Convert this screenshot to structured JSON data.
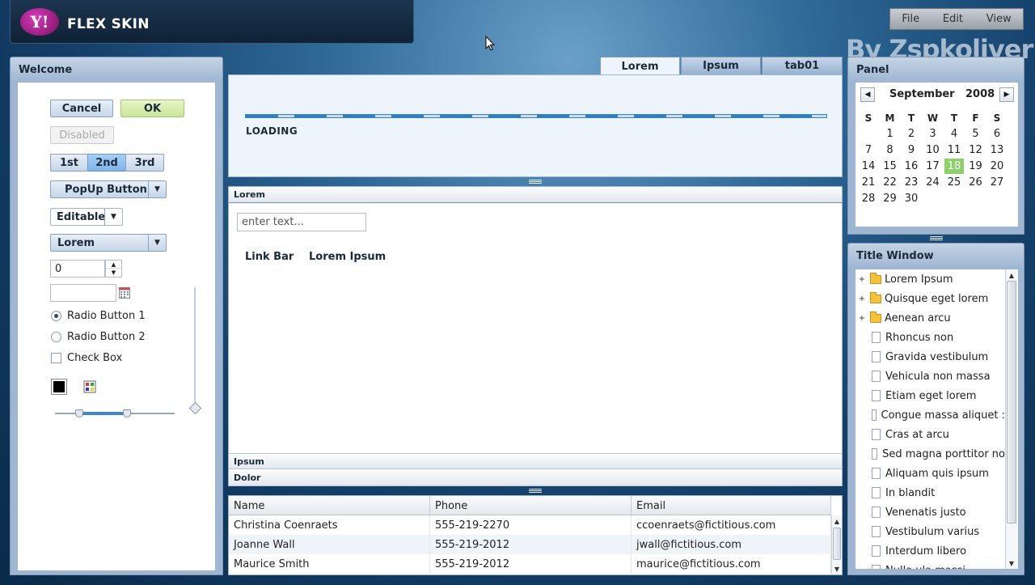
{
  "header": {
    "logo_glyph": "Y!",
    "logo_text": "FLEX SKIN"
  },
  "menubar": {
    "items": [
      "File",
      "Edit",
      "View"
    ]
  },
  "watermark": "By Zspkoliver",
  "welcome": {
    "title": "Welcome",
    "cancel": "Cancel",
    "ok": "OK",
    "disabled": "Disabled",
    "toggle": [
      "1st",
      "2nd",
      "3rd"
    ],
    "popup": "PopUp Button",
    "editable": "Editable",
    "combo": "Lorem",
    "stepper_value": "0",
    "radio1": "Radio Button 1",
    "radio2": "Radio Button 2",
    "checkbox": "Check Box",
    "slider_thumbs": [
      0.2,
      0.6
    ],
    "color_swatch": "#000000"
  },
  "tabs": {
    "items": [
      "Lorem",
      "Ipsum",
      "tab01"
    ],
    "active": "Lorem"
  },
  "progress": {
    "label": "LOADING"
  },
  "accordion": {
    "headers": [
      "Lorem",
      "Ipsum",
      "Dolor"
    ],
    "input_placeholder": "enter text...",
    "linkbar": [
      "Link Bar",
      "Lorem Ipsum"
    ]
  },
  "grid": {
    "columns": [
      "Name",
      "Phone",
      "Email"
    ],
    "rows": [
      [
        "Christina Coenraets",
        "555-219-2270",
        "ccoenraets@fictitious.com"
      ],
      [
        "Joanne Wall",
        "555-219-2012",
        "jwall@fictitious.com"
      ],
      [
        "Maurice Smith",
        "555-219-2012",
        "maurice@fictitious.com"
      ]
    ]
  },
  "calendar": {
    "title": "Panel",
    "month": "September",
    "year": "2008",
    "dow": [
      "S",
      "M",
      "T",
      "W",
      "T",
      "F",
      "S"
    ],
    "weeks": [
      [
        "",
        "1",
        "2",
        "3",
        "4",
        "5",
        "6"
      ],
      [
        "7",
        "8",
        "9",
        "10",
        "11",
        "12",
        "13"
      ],
      [
        "14",
        "15",
        "16",
        "17",
        "18",
        "19",
        "20"
      ],
      [
        "21",
        "22",
        "23",
        "24",
        "25",
        "26",
        "27"
      ],
      [
        "28",
        "29",
        "30",
        "",
        "",
        "",
        ""
      ]
    ],
    "today": "18",
    "today_color": "#8cd06a"
  },
  "titlewindow": {
    "title": "Title Window",
    "tree": [
      {
        "label": "Lorem Ipsum",
        "type": "folder"
      },
      {
        "label": "Quisque eget lorem",
        "type": "folder"
      },
      {
        "label": "Aenean arcu",
        "type": "folder"
      },
      {
        "label": "Rhoncus non",
        "type": "doc"
      },
      {
        "label": "Gravida vestibulum",
        "type": "doc"
      },
      {
        "label": "Vehicula non massa",
        "type": "doc"
      },
      {
        "label": "Etiam eget lorem",
        "type": "doc"
      },
      {
        "label": "Congue massa aliquet :",
        "type": "doc"
      },
      {
        "label": "Cras at arcu",
        "type": "doc"
      },
      {
        "label": "Sed magna porttitor no",
        "type": "doc"
      },
      {
        "label": "Aliquam quis ipsum",
        "type": "doc"
      },
      {
        "label": "In blandit",
        "type": "doc"
      },
      {
        "label": "Venenatis justo",
        "type": "doc"
      },
      {
        "label": "Vestibulum varius",
        "type": "doc"
      },
      {
        "label": "Interdum libero",
        "type": "doc"
      },
      {
        "label": "Nulla ula massi",
        "type": "doc"
      }
    ]
  }
}
